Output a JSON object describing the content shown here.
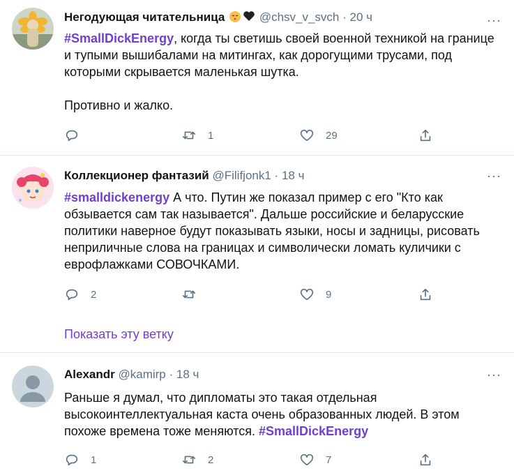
{
  "tweets": [
    {
      "name": "Негодующая читательница",
      "handle": "@chsv_v_svch",
      "sep": "·",
      "time": "20 ч",
      "hashtag": "#SmallDickEnergy",
      "text": ", когда ты светишь своей военной техникой на границе и тупыми вышибалами на митингах, как дорогущими трусами, под которыми скрывается маленькая шутка.\n\nПротивно и жалко.",
      "replies": "",
      "retweets": "1",
      "likes": "29",
      "more": "···"
    },
    {
      "name": "Коллекционер фантазий",
      "handle": "@Filifjonk1",
      "sep": "·",
      "time": "18 ч",
      "hashtag": "#smalldickenergy",
      "text": " А что. Путин же показал пример с его \"Кто как обзывается сам так называется\". Дальше российские и беларусские политики наверное будут показывать языки, носы и задницы, рисовать неприличные слова на границах и символически ломать куличики с еврофлажками СОВОЧКАМИ.",
      "replies": "2",
      "retweets": "",
      "likes": "9",
      "more": "···"
    },
    {
      "name": "Alexandr",
      "handle": "@kamirp",
      "sep": "·",
      "time": "18 ч",
      "text": "Раньше я думал, что дипломаты это такая отдельная высокоинтеллектуальная каста очень образованных людей. В этом похоже времена тоже меняются. ",
      "hashtag": "#SmallDickEnergy",
      "replies": "1",
      "retweets": "2",
      "likes": "7",
      "more": "···"
    }
  ],
  "show_thread": "Показать эту ветку",
  "icons": [
    "reply-icon",
    "retweet-icon",
    "like-icon",
    "share-icon",
    "more-icon"
  ],
  "colors": {
    "hashtag": "#6f3fd2",
    "muted": "#5b7083",
    "text": "#0f1419",
    "divider": "#e1e8ed"
  }
}
